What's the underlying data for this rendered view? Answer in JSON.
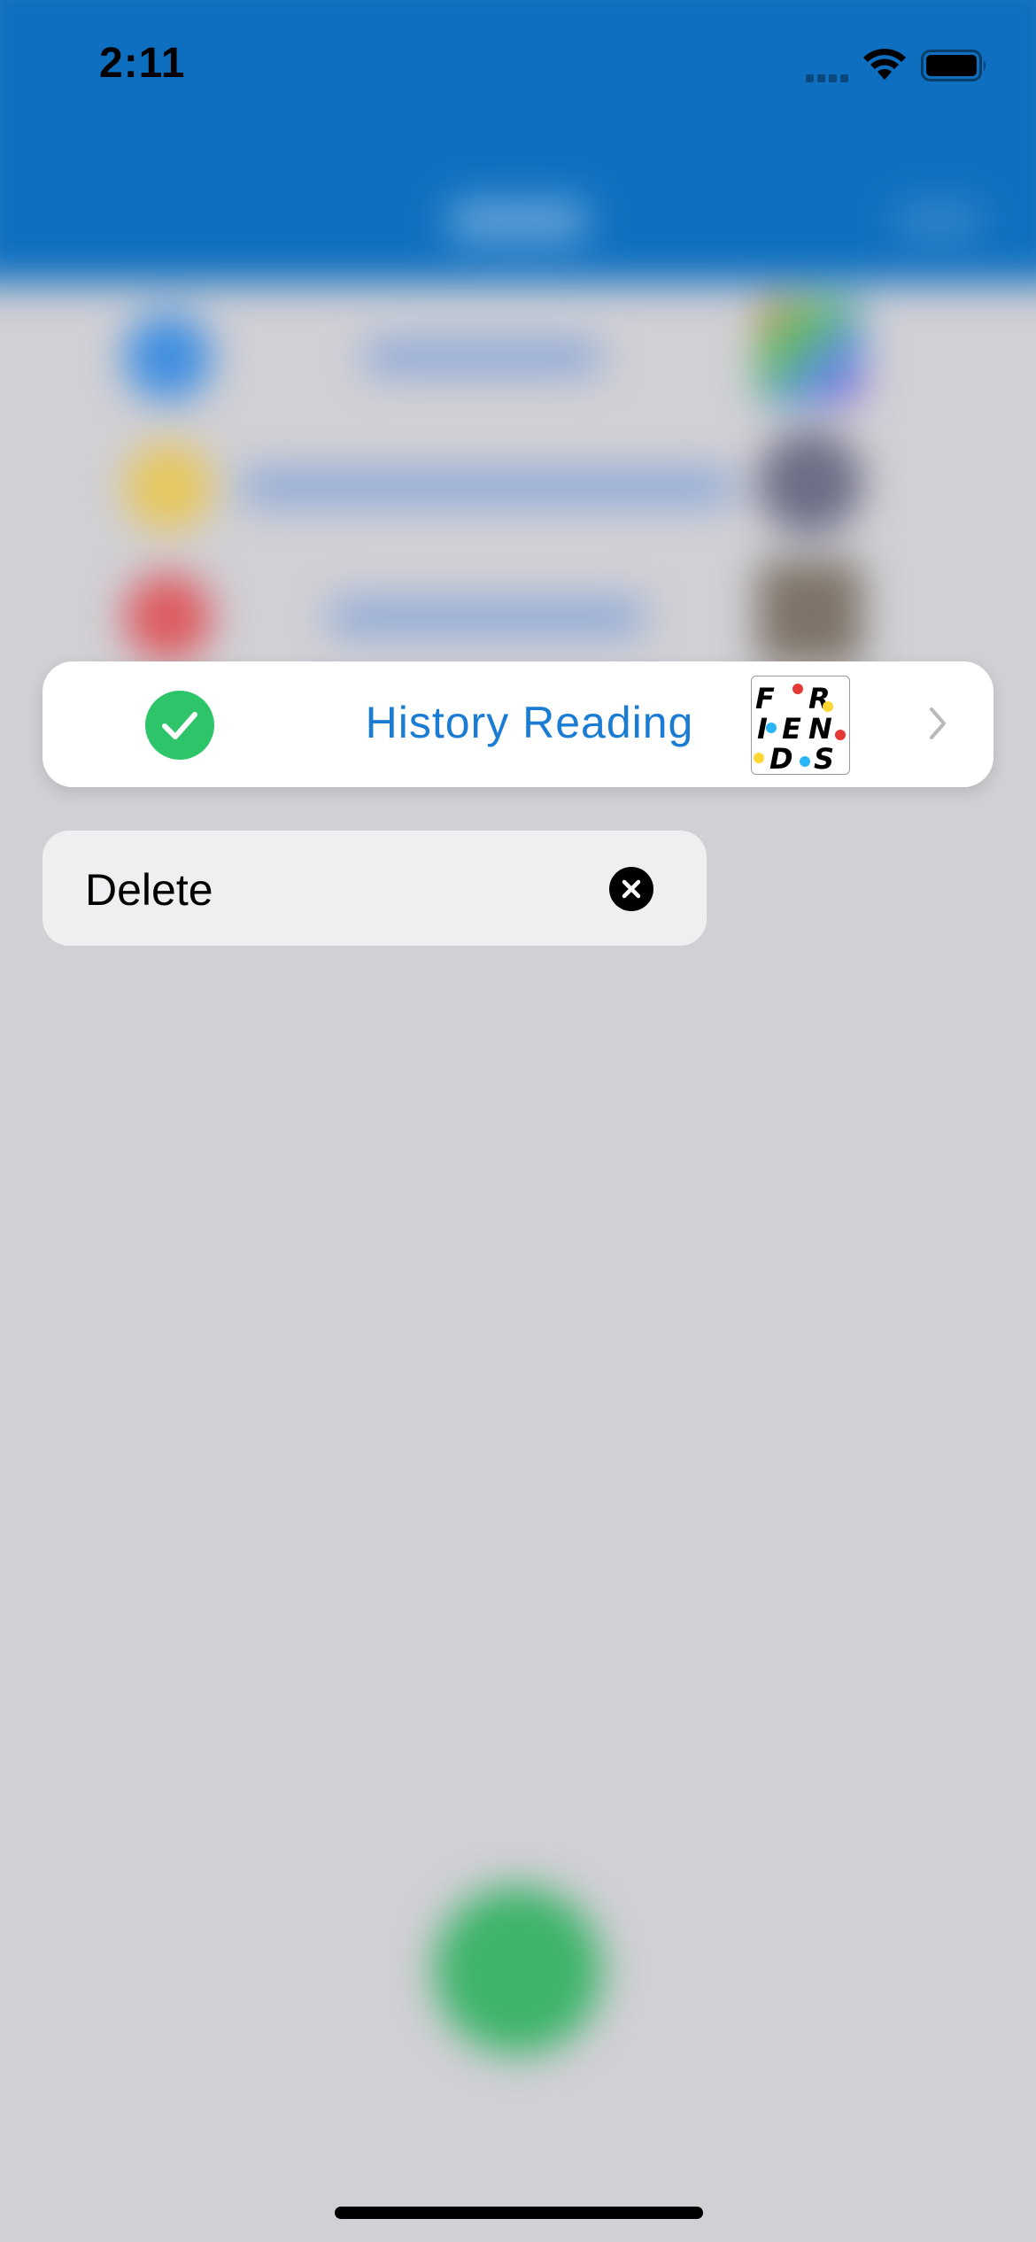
{
  "status_bar": {
    "time": "2:11",
    "icons": [
      "cellular-signal-icon",
      "wifi-icon",
      "battery-icon"
    ]
  },
  "highlighted_row": {
    "title": "History Reading",
    "status_icon": "checkmark-circle-icon",
    "status_color": "#2ec46a",
    "title_color": "#1a7cd3",
    "thumbnail": "friends-logo",
    "thumbnail_letters": [
      "F",
      "R",
      "I",
      "E",
      "N",
      "D",
      "S"
    ],
    "accessory_icon": "chevron-right-icon"
  },
  "context_menu": {
    "items": [
      {
        "label": "Delete",
        "icon": "xmark-circle-icon"
      }
    ]
  },
  "colors": {
    "header_blue": "#0e6fc0",
    "dim_background": "#d1d0d5",
    "fab_green": "#3db36a"
  }
}
